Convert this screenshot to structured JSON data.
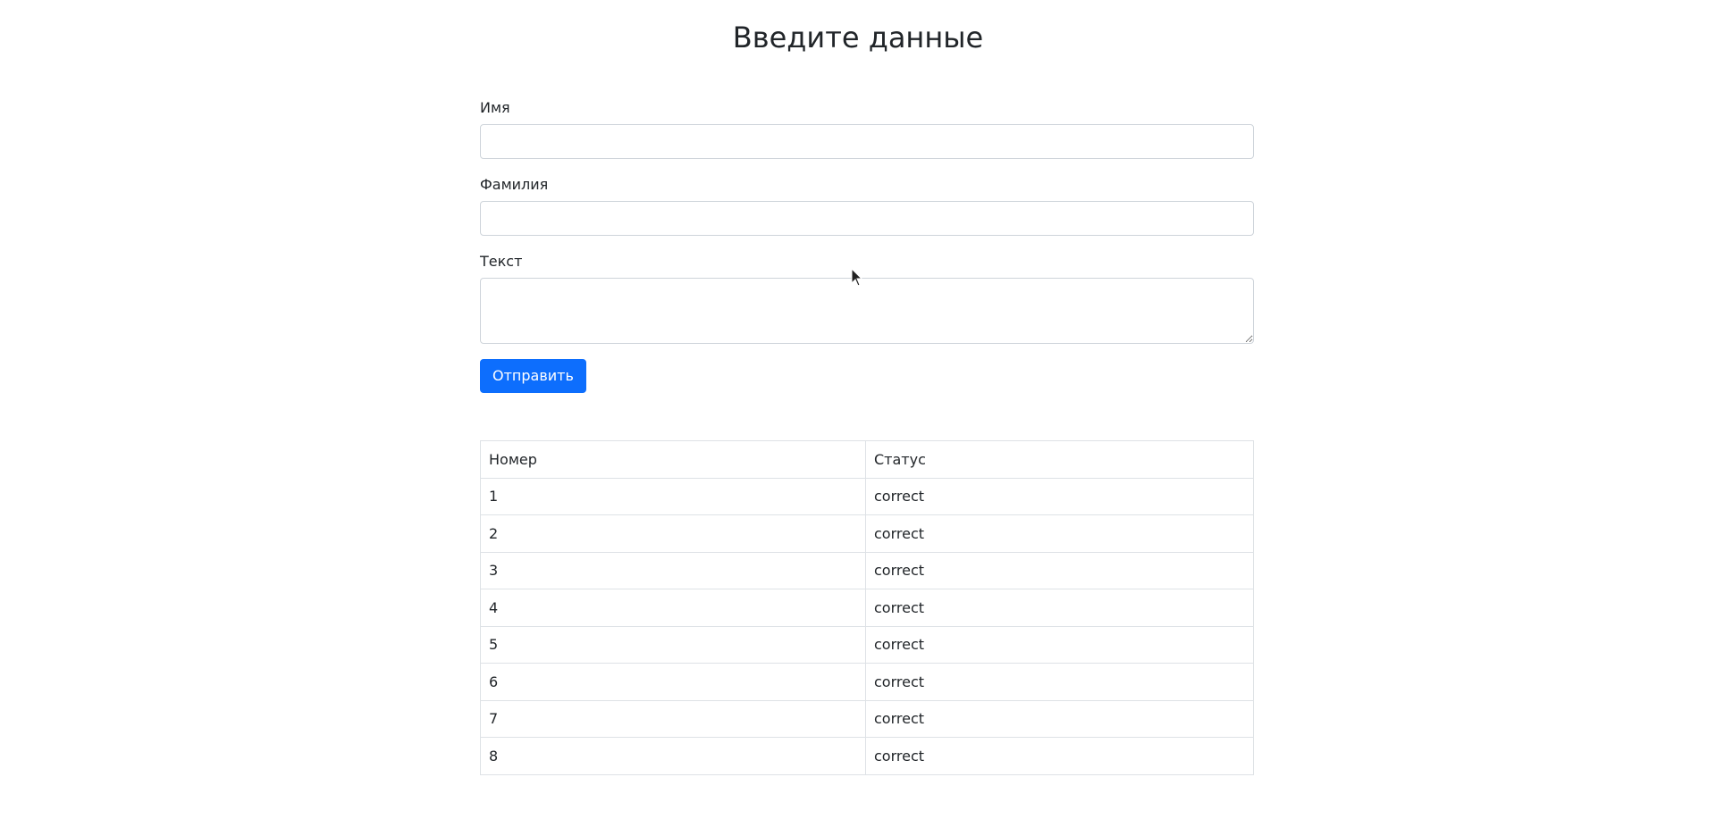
{
  "page": {
    "title": "Введите данные"
  },
  "form": {
    "first_name": {
      "label": "Имя",
      "value": "",
      "placeholder": ""
    },
    "last_name": {
      "label": "Фамилия",
      "value": "",
      "placeholder": ""
    },
    "text": {
      "label": "Текст",
      "value": "",
      "placeholder": ""
    },
    "submit_label": "Отправить"
  },
  "table": {
    "headers": [
      "Номер",
      "Статус"
    ],
    "rows": [
      [
        "1",
        "correct"
      ],
      [
        "2",
        "correct"
      ],
      [
        "3",
        "correct"
      ],
      [
        "4",
        "correct"
      ],
      [
        "5",
        "correct"
      ],
      [
        "6",
        "correct"
      ],
      [
        "7",
        "correct"
      ],
      [
        "8",
        "correct"
      ]
    ]
  },
  "colors": {
    "primary": "#0d6efd",
    "border": "#ced4da",
    "table_border": "#dee2e6",
    "text": "#212529"
  },
  "icons": {
    "cursor": "mouse-pointer-icon"
  }
}
